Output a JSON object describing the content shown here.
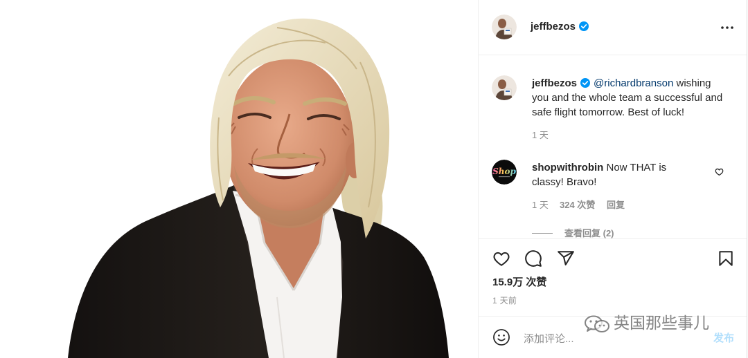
{
  "post": {
    "header": {
      "username": "jeffbezos",
      "avatar_icon": "profile-avatar",
      "verified_icon": "verified-badge-icon",
      "more_icon": "more-options-icon"
    },
    "caption": {
      "username": "jeffbezos",
      "mention": "@richardbranson",
      "text": "wishing you and the whole team a successful and safe flight tomorrow. Best of luck!",
      "time": "1 天"
    },
    "comments": [
      {
        "username": "shopwithrobin",
        "avatar_logo_text": "Shop",
        "text": "Now THAT is classy! Bravo!",
        "time": "1 天",
        "likes": "324 次赞",
        "reply_label": "回复",
        "view_replies_label": "查看回复 (2)",
        "like_icon": "heart-outline-icon"
      }
    ],
    "actions": {
      "like_icon": "heart-icon",
      "comment_icon": "comment-icon",
      "share_icon": "paper-plane-icon",
      "save_icon": "bookmark-icon"
    },
    "likes": "15.9万 次赞",
    "timestamp": "1 天前",
    "add_comment": {
      "emoji_icon": "emoji-icon",
      "placeholder": "添加评论...",
      "post_label": "发布"
    }
  },
  "watermark": {
    "logo_icon": "wechat-icon",
    "text": "英国那些事儿"
  },
  "colors": {
    "text": "#262626",
    "secondary_text": "#8e8e8e",
    "mention": "#00376b",
    "verified": "#0095f6",
    "post_button_disabled": "#b2dffc",
    "divider": "#efefef"
  }
}
